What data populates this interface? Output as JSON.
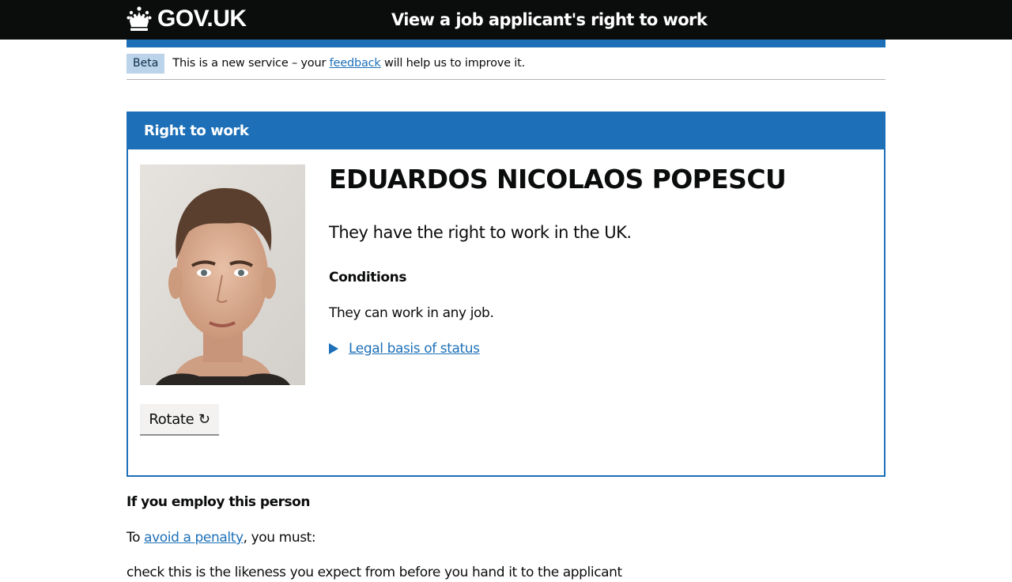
{
  "header": {
    "logo_text": "GOV.UK",
    "logo_icon": "crown-icon",
    "service_name": "View a job applicant's right to work"
  },
  "phase_banner": {
    "tag": "Beta",
    "text_before": "This is a new service – your ",
    "link": "feedback",
    "text_after": " will help us to improve it."
  },
  "card": {
    "title": "Right to work",
    "person_name": "EDUARDOS NICOLAOS POPESCU",
    "status": "They have the right to work in the UK.",
    "conditions_heading": "Conditions",
    "conditions_text": "They can work in any job.",
    "details_summary": "Legal basis of status",
    "rotate_button": "Rotate ↻"
  },
  "employ": {
    "heading": "If you employ this person",
    "text_before": "To ",
    "link": "avoid a penalty",
    "text_after": ", you must:",
    "next_line": "check this is the likeness you expect from before you hand it to the applicant"
  },
  "colors": {
    "brand_blue": "#1d70b8",
    "header_black": "#0b0c0c",
    "tag_background": "#bbd4ea"
  }
}
